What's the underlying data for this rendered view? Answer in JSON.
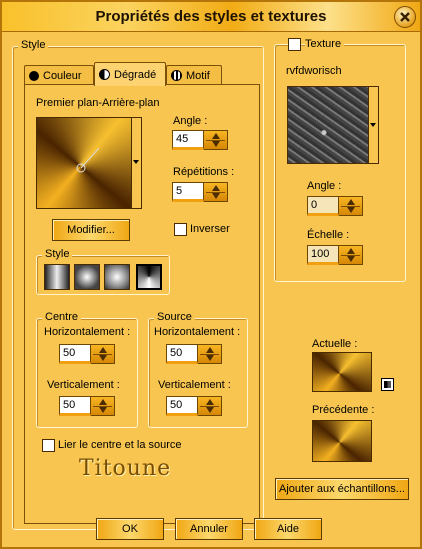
{
  "window": {
    "title": "Propriétés des styles et textures"
  },
  "style_group": {
    "label": "Style"
  },
  "tabs": [
    {
      "label": "Couleur",
      "icon": "circle-icon"
    },
    {
      "label": "Dégradé",
      "icon": "half-circle-icon"
    },
    {
      "label": "Motif",
      "icon": "pattern-icon"
    }
  ],
  "gradient": {
    "name": "Premier plan-Arrière-plan",
    "modify_label": "Modifier...",
    "angle_label": "Angle :",
    "angle_value": "45",
    "repeats_label": "Répétitions :",
    "repeats_value": "5",
    "invert_label": "Inverser",
    "style_label": "Style",
    "centre_label": "Centre",
    "source_label": "Source",
    "centre_h_label": "Horizontalement :",
    "centre_h_value": "50",
    "centre_v_label": "Verticalement :",
    "centre_v_value": "50",
    "source_h_label": "Horizontalement :",
    "source_h_value": "50",
    "source_v_label": "Verticalement :",
    "source_v_value": "50",
    "link_label": "Lier le centre et la source"
  },
  "texture": {
    "checkbox_label": "Texture",
    "name": "rvfdworisch",
    "angle_label": "Angle :",
    "angle_value": "0",
    "scale_label": "Échelle :",
    "scale_value": "100"
  },
  "preview": {
    "current_label": "Actuelle :",
    "previous_label": "Précédente :",
    "add_swatch_label": "Ajouter aux échantillons..."
  },
  "logo_text": "Titoune",
  "footer": {
    "ok_label": "OK",
    "cancel_label": "Annuler",
    "help_label": "Aide"
  }
}
